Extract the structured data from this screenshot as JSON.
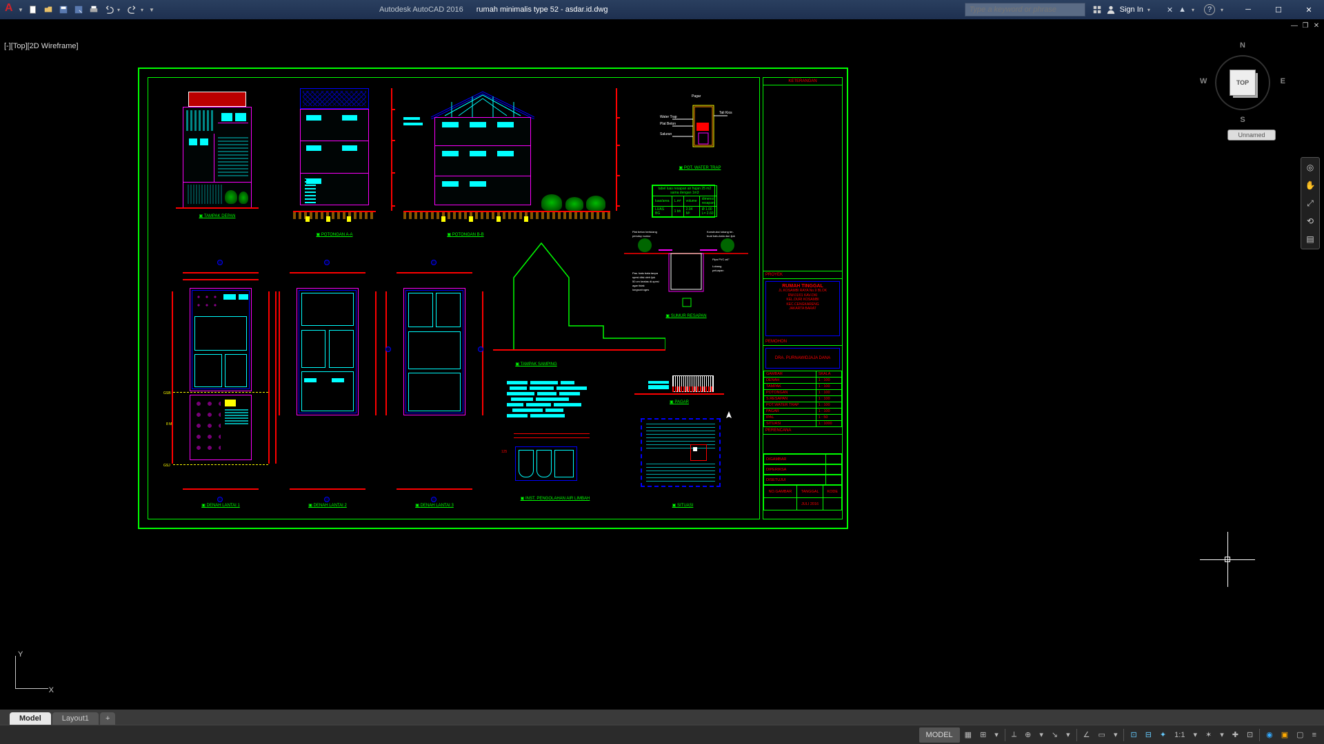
{
  "app": {
    "name": "Autodesk AutoCAD 2016",
    "file": "rumah minimalis type 52 - asdar.id.dwg"
  },
  "search": {
    "placeholder": "Type a keyword or phrase"
  },
  "signin": {
    "label": "Sign In"
  },
  "viewport": {
    "label": "[-][Top][2D Wireframe]"
  },
  "viewcube": {
    "top": "TOP",
    "n": "N",
    "s": "S",
    "e": "E",
    "w": "W",
    "unnamed": "Unnamed"
  },
  "ucs": {
    "x": "X",
    "y": "Y"
  },
  "tabs": {
    "model": "Model",
    "layout1": "Layout1",
    "plus": "+"
  },
  "statusbar": {
    "model": "MODEL",
    "scale": "1:1"
  },
  "titleblock": {
    "keterangan": "KETERANGAN",
    "proyek": "PROYEK",
    "project_name": "RUMAH TINGGAL",
    "project_lines": "JL.KOSAMBI RAYA No.9 BLOK\nRW.01/01 KAV-DKI\nKEL.DURI KOSAMBI\nKEC.CENGKARENG\nJAKARTA BARAT",
    "pemohon": "PEMOHON",
    "owner": "DRA. PURNAWIDJAJA DANA",
    "gambar": "GAMBAR",
    "skala": "SKALA",
    "rows": [
      {
        "g": "DENAH",
        "s": "1 : 100"
      },
      {
        "g": "TAMPAK",
        "s": "1 : 100"
      },
      {
        "g": "POTONGAN",
        "s": "1 : 100"
      },
      {
        "g": "S.RESAPAN",
        "s": "1 : 100"
      },
      {
        "g": "POT.WATER TRAP",
        "s": "1 : 100"
      },
      {
        "g": "PAGAR",
        "s": "1 : 100"
      },
      {
        "g": "IPAL",
        "s": "1 : 50"
      },
      {
        "g": "SITUASI",
        "s": "1 : 1000"
      }
    ],
    "perencana": "PERENCANA",
    "digambar": "DIGAMBAR",
    "diperiksa": "DIPERIKSA",
    "disetujui": "DISETUJUI",
    "no_gambar": "NO.GAMBAR",
    "tanggal": "TANGGAL",
    "kode": "KODE",
    "date": "JULI 2016"
  },
  "views": {
    "tampak_depan": "TAMPAK DEPAN",
    "potongan_aa": "POTONGAN A-A",
    "potongan_bb": "POTONGAN B-B",
    "denah1": "DENAH LANTAI 1",
    "denah2": "DENAH LANTAI 2",
    "denah3": "DENAH LANTAI 3",
    "tampak_samping": "TAMPAK SAMPING",
    "ipal": "INST. PENGOLAHAN AIR LIMBAH",
    "water_trap": "POT. WATER TRAP",
    "sumur": "SUMUR RESAPAN",
    "pagar": "PAGAR",
    "situasi": "SITUASI"
  },
  "septic_table": {
    "title": "tabel luas resapan air hujan\n25 m2 sama dengan 1m3",
    "h1": "luas/area",
    "h2": "L.m²",
    "h3": "volume",
    "h4": "dimensi\nresapan",
    "r1": "LUAS BG",
    "r2": "1 bh",
    "r3": "2.04 M³",
    "r4": "Ø 1.00\nL= 2.60"
  }
}
